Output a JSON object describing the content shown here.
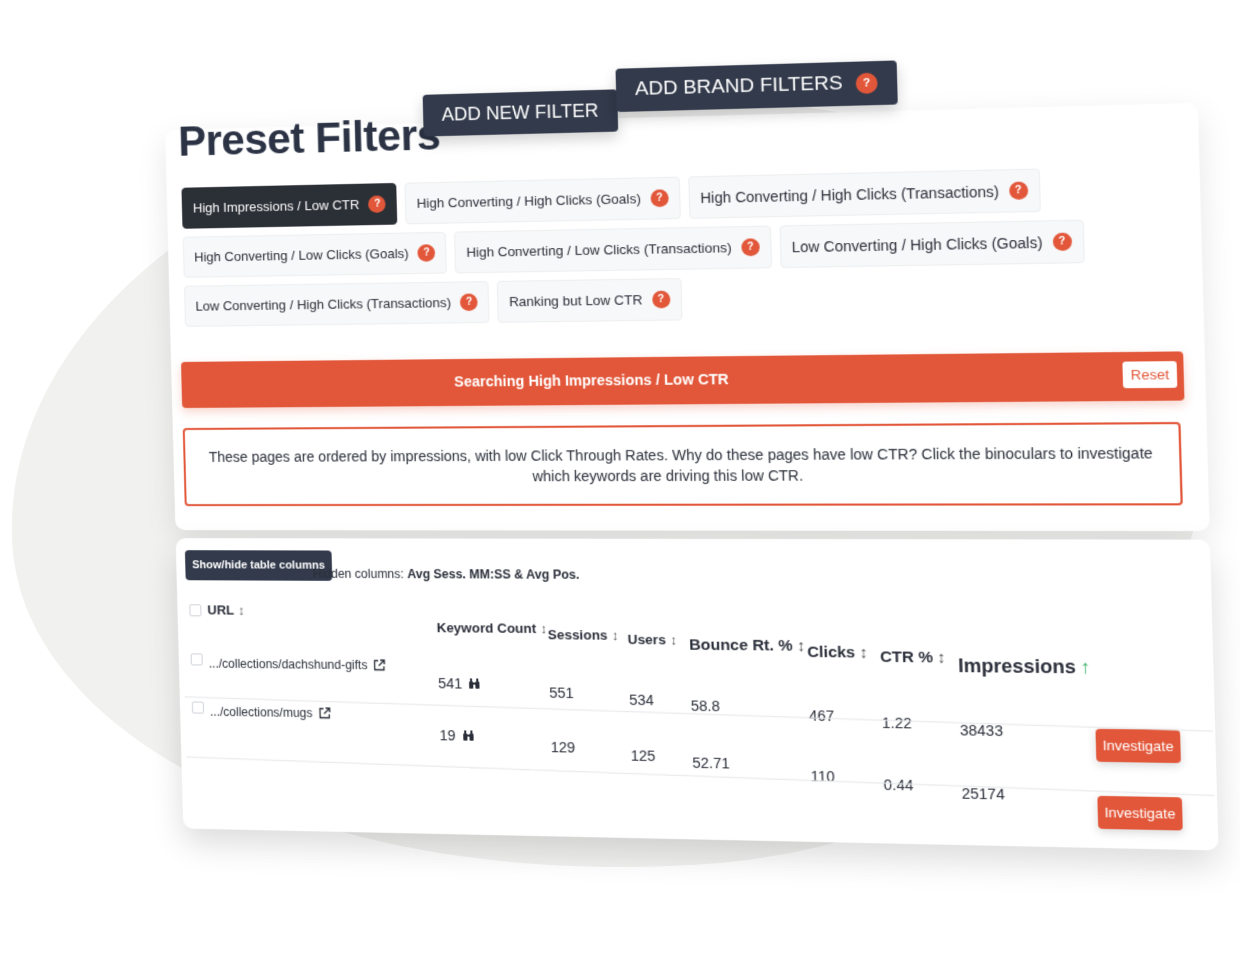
{
  "header": {
    "title": "Preset Filters",
    "add_new_filter": "ADD NEW FILTER",
    "add_brand_filters": "ADD BRAND FILTERS"
  },
  "help_glyph": "?",
  "presets": [
    {
      "label": "High Impressions / Low CTR",
      "active": true
    },
    {
      "label": "High Converting / High Clicks (Goals)"
    },
    {
      "label": "High Converting / High Clicks (Transactions)"
    },
    {
      "label": "High Converting / Low Clicks (Goals)"
    },
    {
      "label": "High Converting / Low Clicks (Transactions)"
    },
    {
      "label": "Low Converting / High Clicks (Goals)"
    },
    {
      "label": "Low Converting / High Clicks (Transactions)"
    },
    {
      "label": "Ranking but Low CTR"
    }
  ],
  "search": {
    "text": "Searching High Impressions / Low CTR",
    "reset": "Reset"
  },
  "info": "These pages are ordered by impressions, with low Click Through Rates. Why do these pages have low CTR? Click the binoculars to investigate which keywords are driving this low CTR.",
  "table": {
    "toggle_columns": "Show/hide table columns",
    "hidden_label": "Hidden columns:",
    "hidden_value": "Avg Sess. MM:SS & Avg Pos.",
    "columns": {
      "url": "URL",
      "keyword_count": "Keyword Count",
      "sessions": "Sessions",
      "users": "Users",
      "bounce": "Bounce Rt. %",
      "clicks": "Clicks",
      "ctr": "CTR %",
      "impressions": "Impressions"
    },
    "sort_glyph": "↕",
    "sorted_glyph": "↑",
    "rows": [
      {
        "url": ".../collections/dachshund-gifts",
        "keyword_count": "541",
        "sessions": "551",
        "users": "534",
        "bounce": "58.8",
        "clicks": "467",
        "ctr": "1.22",
        "impressions": "38433",
        "action": "Investigate"
      },
      {
        "url": ".../collections/mugs",
        "keyword_count": "19",
        "sessions": "129",
        "users": "125",
        "bounce": "52.71",
        "clicks": "110",
        "ctr": "0.44",
        "impressions": "25174",
        "action": "Investigate"
      }
    ]
  },
  "colors": {
    "accent": "#e2573a",
    "dark_button": "#323a4b",
    "sort_active": "#3db36b"
  },
  "icons": [
    "help-icon",
    "external-link-icon",
    "binoculars-icon",
    "sort-icon",
    "sort-ascending-icon"
  ]
}
